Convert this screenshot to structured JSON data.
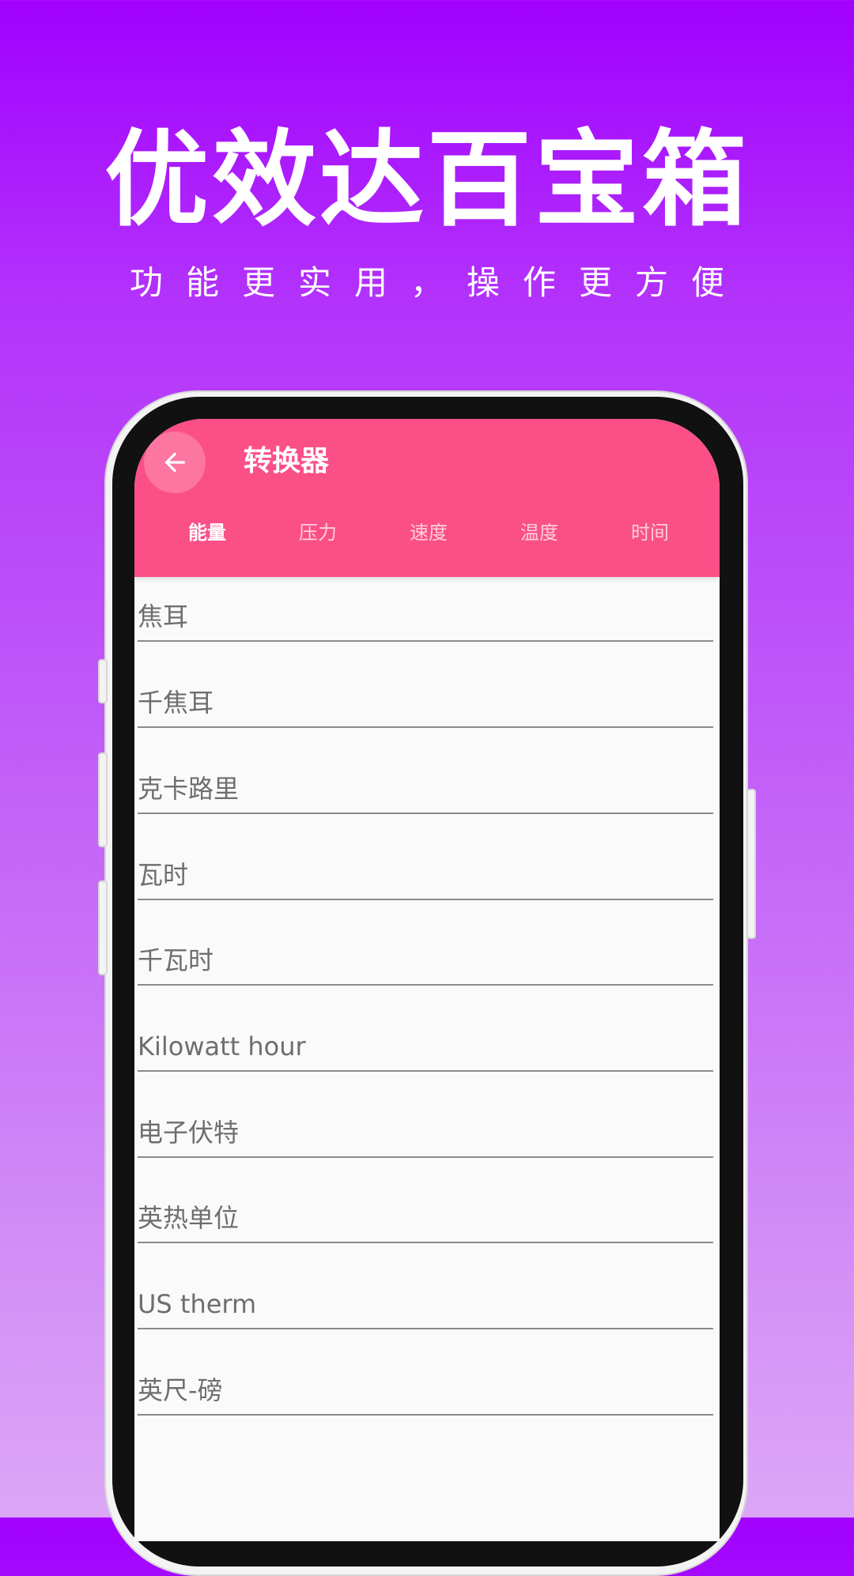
{
  "promo": {
    "title": "优效达百宝箱",
    "subtitle": "功能更实用，操作更方便"
  },
  "app_bar": {
    "back_icon": "arrow-left-icon",
    "title": "转换器"
  },
  "tabs": [
    {
      "label": "能量",
      "active": true
    },
    {
      "label": "压力",
      "active": false
    },
    {
      "label": "速度",
      "active": false
    },
    {
      "label": "温度",
      "active": false
    },
    {
      "label": "时间",
      "active": false
    }
  ],
  "units": [
    {
      "label": "焦耳"
    },
    {
      "label": "千焦耳"
    },
    {
      "label": "克卡路里"
    },
    {
      "label": "瓦时"
    },
    {
      "label": "千瓦时"
    },
    {
      "label": "Kilowatt hour"
    },
    {
      "label": "电子伏特"
    },
    {
      "label": "英热单位"
    },
    {
      "label": "US therm"
    },
    {
      "label": "英尺-磅"
    }
  ],
  "colors": {
    "background_top": "#a100ff",
    "background_bottom": "#dca7f6",
    "app_bar": "#fb5087",
    "screen_bg": "#fafafa",
    "bezel": "#111111",
    "unit_text": "#6e6e6e"
  }
}
